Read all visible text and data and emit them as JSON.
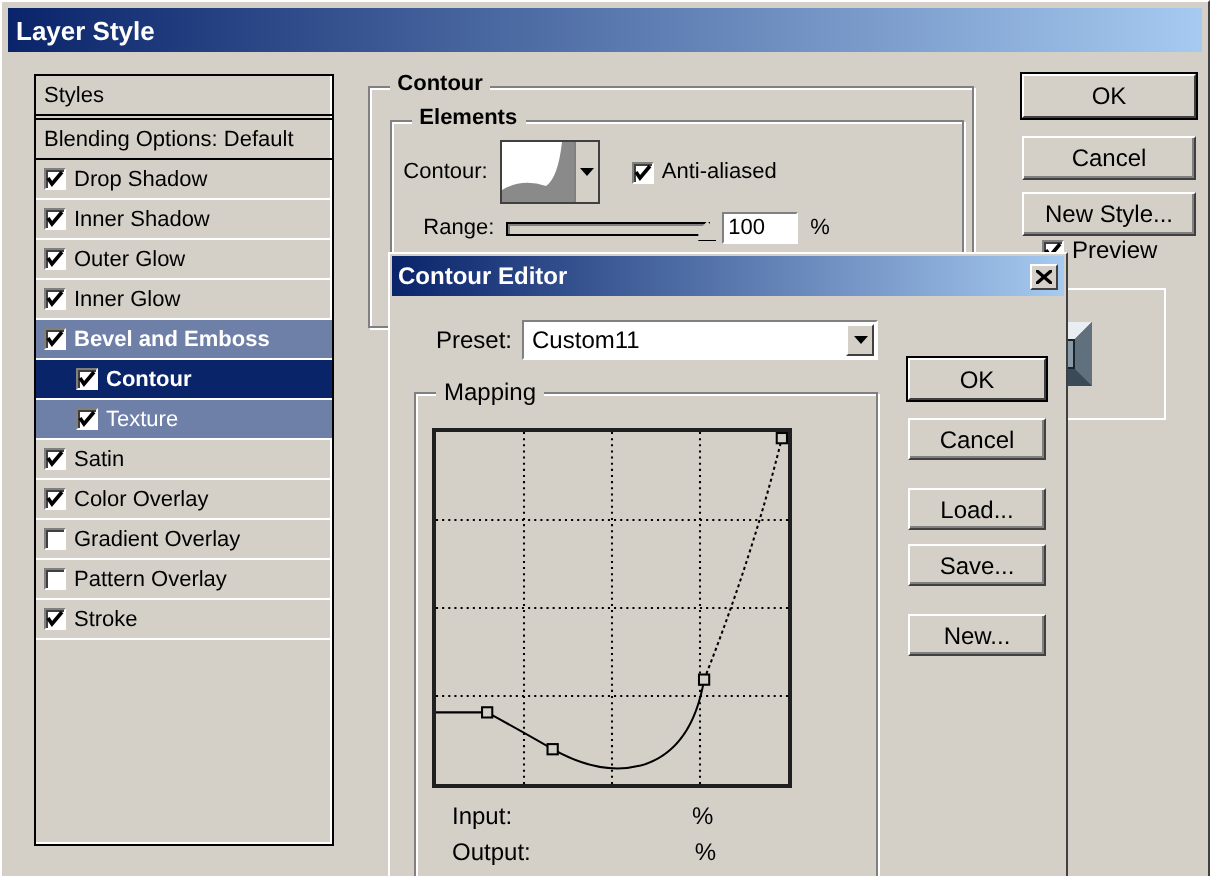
{
  "window": {
    "title": "Layer Style"
  },
  "styles_list": {
    "header": "Styles",
    "blending": "Blending Options: Default",
    "items": [
      {
        "label": "Drop Shadow",
        "checked": true,
        "selected": false
      },
      {
        "label": "Inner Shadow",
        "checked": true,
        "selected": false
      },
      {
        "label": "Outer Glow",
        "checked": true,
        "selected": false
      },
      {
        "label": "Inner Glow",
        "checked": true,
        "selected": false
      },
      {
        "label": "Bevel and Emboss",
        "checked": true,
        "selected": false,
        "children": [
          {
            "label": "Contour",
            "checked": true,
            "selected": true
          },
          {
            "label": "Texture",
            "checked": true,
            "selected": false
          }
        ]
      },
      {
        "label": "Satin",
        "checked": true,
        "selected": false
      },
      {
        "label": "Color Overlay",
        "checked": true,
        "selected": false
      },
      {
        "label": "Gradient Overlay",
        "checked": false,
        "selected": false
      },
      {
        "label": "Pattern Overlay",
        "checked": false,
        "selected": false
      },
      {
        "label": "Stroke",
        "checked": true,
        "selected": false
      }
    ]
  },
  "contour_panel": {
    "title": "Contour",
    "group": "Elements",
    "contour_label": "Contour:",
    "anti_aliased": {
      "label": "Anti-aliased",
      "checked": true
    },
    "range": {
      "label": "Range:",
      "level": 1,
      "value": "100",
      "unit": "%"
    }
  },
  "buttons": [
    {
      "label": "OK",
      "default": true
    },
    {
      "label": "Cancel",
      "default": false
    },
    {
      "label": "New Style...",
      "default": false
    }
  ],
  "preview": {
    "label": "Preview",
    "checked": true
  },
  "contour_editor": {
    "title": "Contour Editor",
    "preset_label": "Preset:",
    "preset": "Custom11",
    "mapping": "Mapping",
    "input_label": "Input:",
    "input_unit": "%",
    "output_label": "Output:",
    "output_unit": "%",
    "buttons": [
      {
        "label": "OK",
        "default": true
      },
      {
        "label": "Cancel",
        "default": false
      },
      {
        "label": "Load...",
        "default": false
      },
      {
        "label": "Save...",
        "default": false
      },
      {
        "label": "New...",
        "default": false
      }
    ]
  }
}
